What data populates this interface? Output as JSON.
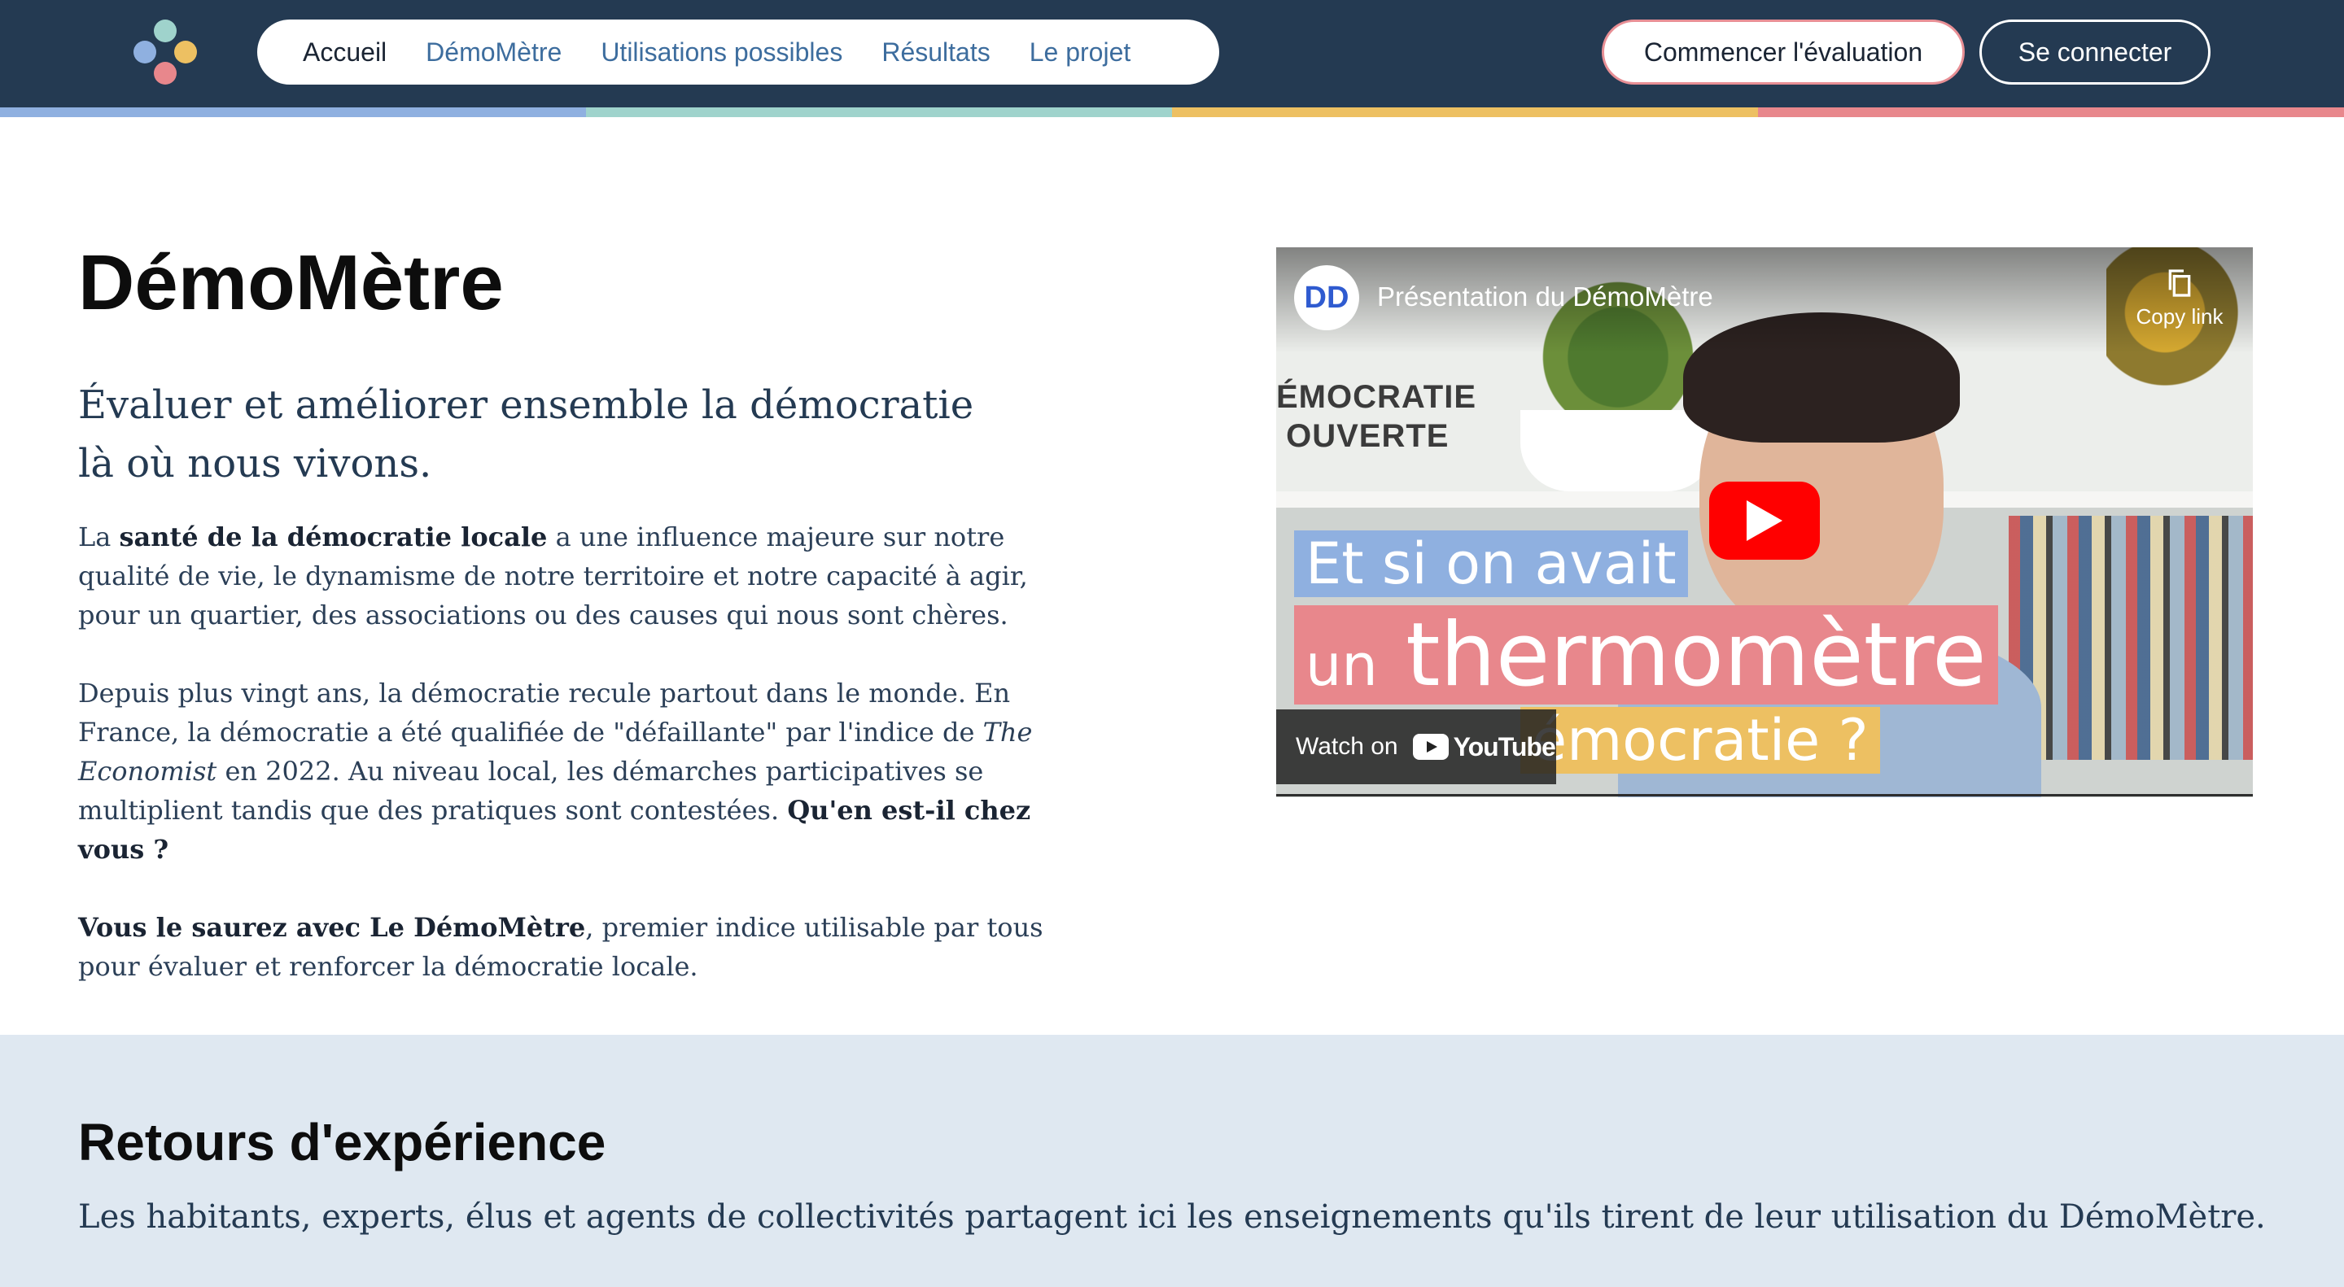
{
  "header": {
    "logo_dot_colors": [
      "#8fb0e0",
      "#9fd3cc",
      "#edc062",
      "#e8878c"
    ],
    "nav": [
      {
        "label": "Accueil",
        "active": true
      },
      {
        "label": "DémoMètre",
        "active": false
      },
      {
        "label": "Utilisations possibles",
        "active": false
      },
      {
        "label": "Résultats",
        "active": false
      },
      {
        "label": "Le projet",
        "active": false
      }
    ],
    "start_button_label": "Commencer l'évaluation",
    "login_button_label": "Se connecter",
    "stripe_colors": [
      "#8fb0e0",
      "#9fd3cc",
      "#edc062",
      "#e8878c"
    ]
  },
  "hero": {
    "title": "DémoMètre",
    "subtitle": "Évaluer et améliorer ensemble la démocratie là où nous vivons.",
    "p1": {
      "prefix": "La ",
      "bold": "santé de la démocratie locale",
      "suffix": " a une influence majeure sur notre qualité de vie, le dynamisme de notre territoire et notre capacité à agir, pour un quartier, des associations ou des causes qui nous sont chères."
    },
    "p2": {
      "prefix": "Depuis plus vingt ans, la démocratie recule partout dans le monde. En France, la démocratie a été qualifiée de \"défaillante\" par l'indice de ",
      "italic": "The Economist",
      "middle": " en 2022. Au niveau local, les démarches participatives se multiplient tandis que des pratiques sont contestées. ",
      "bold": "Qu'en est-il chez vous ?"
    },
    "p3": {
      "bold": "Vous le saurez avec Le DémoMètre",
      "suffix": ", premier indice utilisable par tous pour évaluer et renforcer la démocratie locale."
    }
  },
  "video": {
    "title": "Présentation du DémoMètre",
    "channel_initials": "DD",
    "copy_link_label": "Copy link",
    "background_text": "ÉMOCRATIE\n OUVERTE",
    "caption_line1": "Et si on avait",
    "caption_line2_small": "un",
    "caption_line2_big": "thermomètre",
    "caption_line3": "émocratie ?",
    "watch_on_label": "Watch on",
    "youtube_label": "YouTube",
    "colors": {
      "play": "#ff0000",
      "caption_blue": "#8fb0e0",
      "caption_pink": "#e8878c",
      "caption_yellow": "#edc062"
    }
  },
  "retours": {
    "title": "Retours d'expérience",
    "text": "Les habitants, experts, élus et agents de collectivités partagent ici les enseignements qu'ils tirent de leur utilisation du DémoMètre."
  }
}
